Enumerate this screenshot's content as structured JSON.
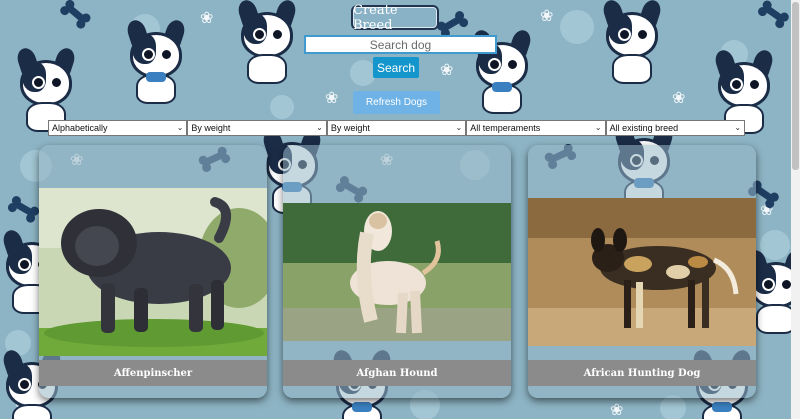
{
  "header": {
    "create_label": "Create Breed",
    "search_placeholder": "Search dog",
    "search_label": "Search",
    "refresh_label": "Refresh Dogs"
  },
  "filters": [
    {
      "name": "sort-order-select",
      "value": "Alphabetically"
    },
    {
      "name": "weight-sort-select",
      "value": "By weight"
    },
    {
      "name": "weight-filter-select",
      "value": "By weight"
    },
    {
      "name": "temperament-select",
      "value": "All temperaments"
    },
    {
      "name": "breed-source-select",
      "value": "All existing breed"
    }
  ],
  "cards": [
    {
      "name": "Affenpinscher"
    },
    {
      "name": "Afghan Hound"
    },
    {
      "name": "African Hunting Dog"
    }
  ],
  "colors": {
    "background": "#8db4c4",
    "accent": "#1496cd",
    "card_label_bar": "#8b8b8b"
  }
}
